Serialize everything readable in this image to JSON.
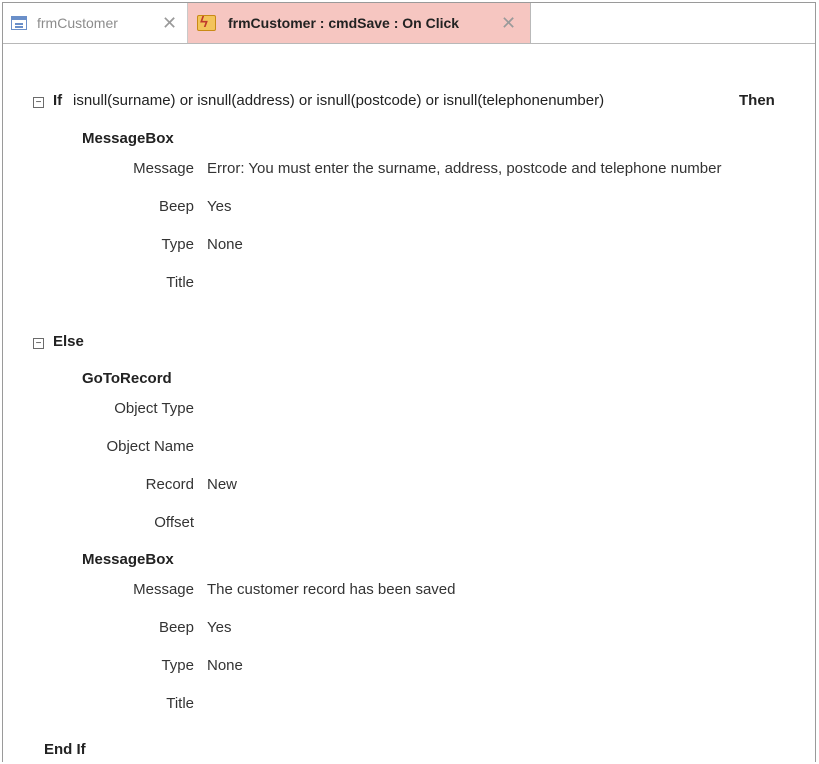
{
  "tabs": [
    {
      "label": "frmCustomer",
      "icon": "form-icon",
      "active": false
    },
    {
      "label": "frmCustomer : cmdSave : On Click",
      "icon": "macro-icon",
      "active": true
    }
  ],
  "macro": {
    "if_keyword": "If",
    "condition": "isnull(surname) or isnull(address) or isnull(postcode) or isnull(telephonenumber)",
    "then_keyword": "Then",
    "then_action": {
      "name": "MessageBox",
      "args": [
        {
          "label": "Message",
          "value": "Error: You must enter the surname, address, postcode and telephone number"
        },
        {
          "label": "Beep",
          "value": "Yes"
        },
        {
          "label": "Type",
          "value": "None"
        },
        {
          "label": "Title",
          "value": ""
        }
      ]
    },
    "else_keyword": "Else",
    "else_actions": [
      {
        "name": "GoToRecord",
        "args": [
          {
            "label": "Object Type",
            "value": ""
          },
          {
            "label": "Object Name",
            "value": ""
          },
          {
            "label": "Record",
            "value": "New"
          },
          {
            "label": "Offset",
            "value": ""
          }
        ]
      },
      {
        "name": "MessageBox",
        "args": [
          {
            "label": "Message",
            "value": "The customer record has been saved"
          },
          {
            "label": "Beep",
            "value": "Yes"
          },
          {
            "label": "Type",
            "value": "None"
          },
          {
            "label": "Title",
            "value": ""
          }
        ]
      }
    ],
    "end_keyword": "End If",
    "toggle_symbol": "−"
  },
  "colors": {
    "active_tab_bg": "#f6c6c1",
    "inactive_tab_text": "#8c8c8c"
  }
}
